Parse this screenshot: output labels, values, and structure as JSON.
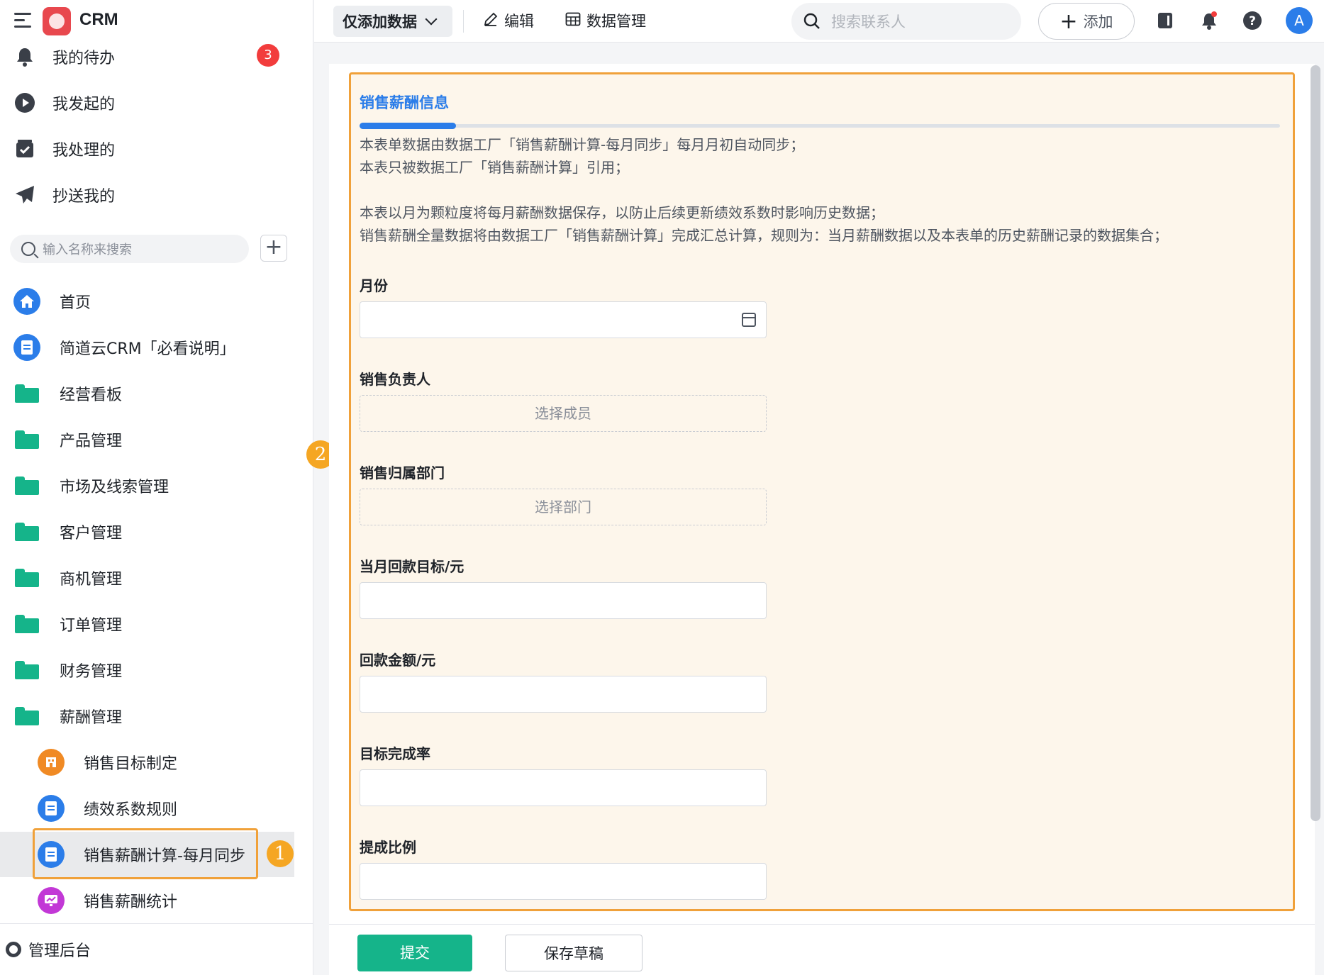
{
  "app": {
    "title": "CRM",
    "logo_text": "CRM"
  },
  "sidebar": {
    "todo": [
      {
        "label": "我的待办",
        "badge": "3"
      },
      {
        "label": "我发起的"
      },
      {
        "label": "我处理的"
      },
      {
        "label": "抄送我的"
      }
    ],
    "search_placeholder": "输入名称来搜索",
    "nav": [
      {
        "label": "首页"
      },
      {
        "label": "简道云CRM「必看说明」"
      },
      {
        "label": "经营看板"
      },
      {
        "label": "产品管理"
      },
      {
        "label": "市场及线索管理"
      },
      {
        "label": "客户管理"
      },
      {
        "label": "商机管理"
      },
      {
        "label": "订单管理"
      },
      {
        "label": "财务管理"
      },
      {
        "label": "薪酬管理"
      }
    ],
    "subnav": [
      {
        "label": "销售目标制定"
      },
      {
        "label": "绩效系数规则"
      },
      {
        "label": "销售薪酬计算-每月同步"
      },
      {
        "label": "销售薪酬统计"
      }
    ],
    "admin_label": "管理后台",
    "step_badges": [
      "1",
      "2"
    ]
  },
  "topbar": {
    "mode": "仅添加数据",
    "edit": "编辑",
    "data_manage": "数据管理",
    "search_placeholder": "搜索联系人",
    "add": "添加",
    "avatar": "A"
  },
  "form": {
    "section_title": "销售薪酬信息",
    "description": [
      "本表单数据由数据工厂「销售薪酬计算-每月同步」每月月初自动同步；",
      "本表只被数据工厂「销售薪酬计算」引用；",
      "",
      "本表以月为颗粒度将每月薪酬数据保存，以防止后续更新绩效系数时影响历史数据；",
      "销售薪酬全量数据将由数据工厂「销售薪酬计算」完成汇总计算，规则为：当月薪酬数据以及本表单的历史薪酬记录的数据集合；"
    ],
    "fields": [
      {
        "label": "月份",
        "type": "date",
        "value": ""
      },
      {
        "label": "销售负责人",
        "type": "member",
        "placeholder": "选择成员"
      },
      {
        "label": "销售归属部门",
        "type": "dept",
        "placeholder": "选择部门"
      },
      {
        "label": "当月回款目标/元",
        "type": "number",
        "value": ""
      },
      {
        "label": "回款金额/元",
        "type": "number",
        "value": ""
      },
      {
        "label": "目标完成率",
        "type": "number",
        "value": ""
      },
      {
        "label": "提成比例",
        "type": "number",
        "value": ""
      }
    ],
    "submit": "提交",
    "save_draft": "保存草稿"
  },
  "colors": {
    "primary": "#2b7de9",
    "success": "#15b48a",
    "highlight": "#f0a13a",
    "danger": "#f23c3c"
  }
}
